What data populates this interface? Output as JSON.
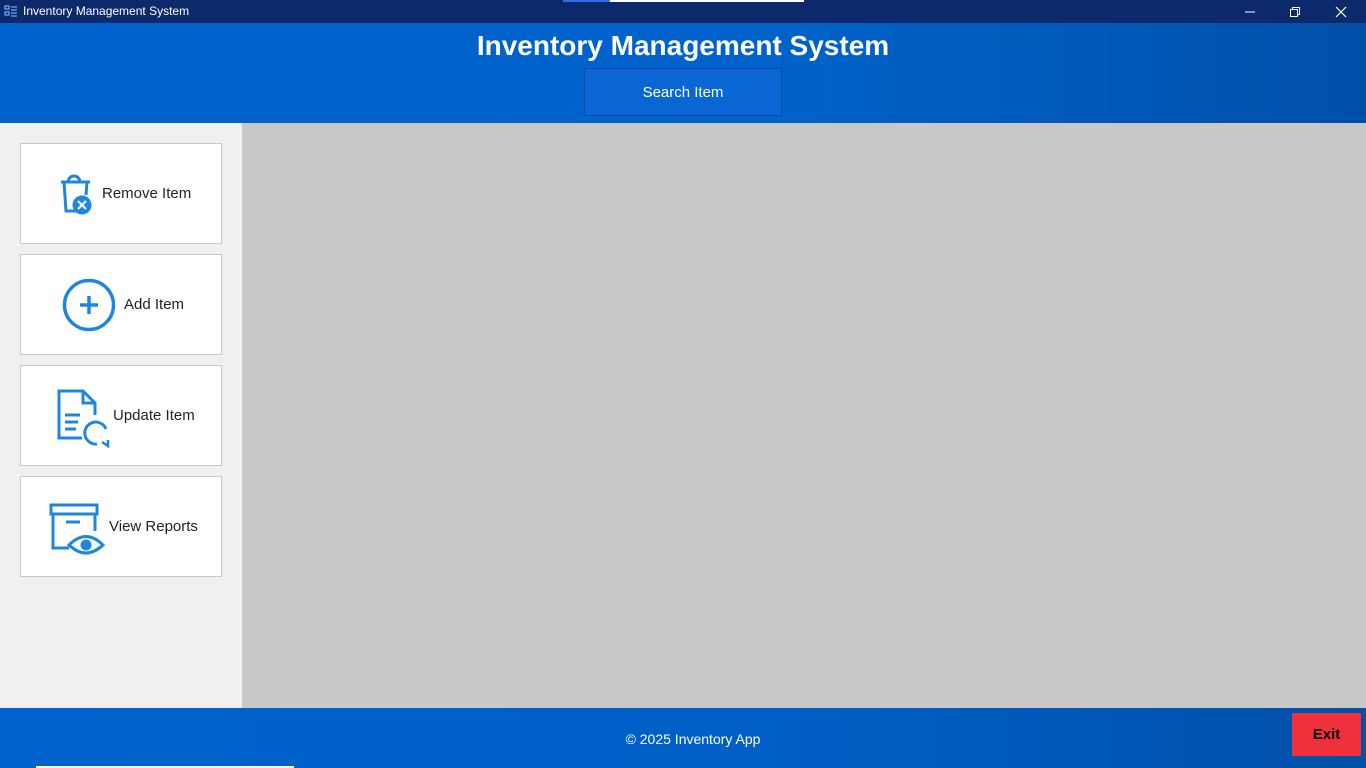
{
  "window": {
    "title": "Inventory Management System",
    "controls": {
      "minimize": "minimize-icon",
      "restore": "restore-icon",
      "close": "close-icon"
    }
  },
  "header": {
    "title": "Inventory Management System",
    "search_label": "Search Item"
  },
  "sidebar": {
    "items": [
      {
        "label": "Remove Item",
        "icon": "trash-remove-icon"
      },
      {
        "label": "Add Item",
        "icon": "plus-circle-icon"
      },
      {
        "label": "Update Item",
        "icon": "document-refresh-icon"
      },
      {
        "label": "View Reports",
        "icon": "archive-eye-icon"
      }
    ]
  },
  "footer": {
    "copyright": "© 2025 Inventory App",
    "exit_label": "Exit"
  },
  "colors": {
    "titlebar": "#0c2a6b",
    "brand_blue": "#0062cc",
    "icon_blue": "#1f86e0",
    "content_bg": "#c8c8c8",
    "exit_red": "#f0303a"
  }
}
